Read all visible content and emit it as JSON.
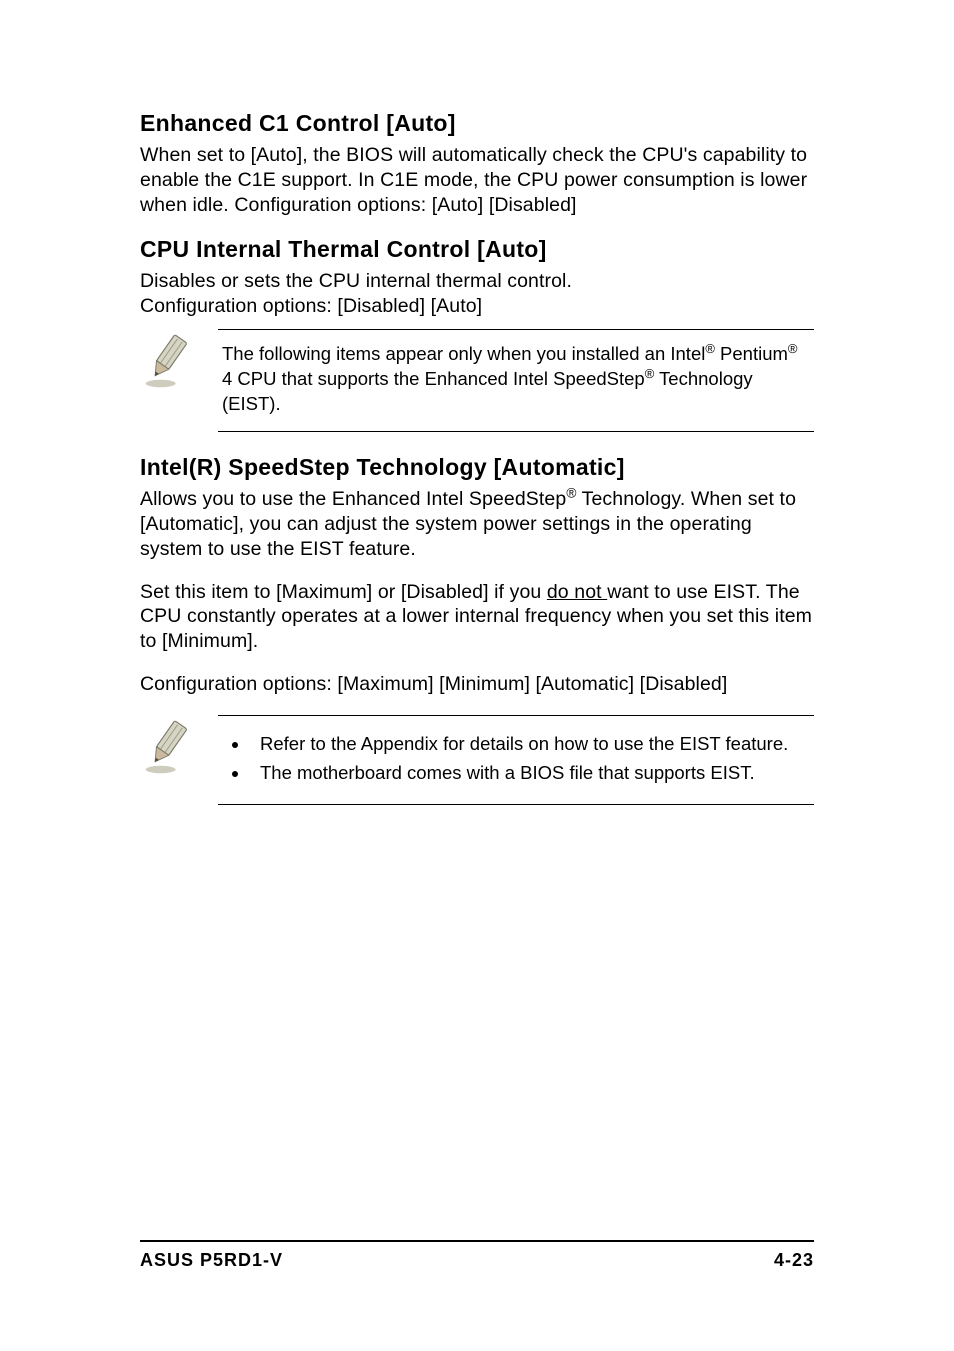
{
  "sections": {
    "s1": {
      "heading": "Enhanced C1 Control [Auto]",
      "body": "When set to [Auto], the BIOS will automatically check the CPU's capability to enable the C1E support. In C1E mode, the CPU power consumption is lower when idle. Configuration options: [Auto] [Disabled]"
    },
    "s2": {
      "heading": "CPU Internal Thermal Control [Auto]",
      "body": "Disables or sets the CPU internal thermal control.\nConfiguration options: [Disabled] [Auto]"
    },
    "note1": {
      "pre": "The following items appear only when you installed an Intel",
      "mid": " Pentium",
      "post": " 4 CPU that supports the Enhanced Intel SpeedStep",
      "tail": " Technology (EIST)."
    },
    "s3": {
      "heading": "Intel(R) SpeedStep Technology [Automatic]",
      "p1_pre": "Allows you to use the Enhanced Intel SpeedStep",
      "p1_post": " Technology. When set to [Automatic], you can adjust the system power settings in the operating system to use the EIST feature.",
      "p2_pre": "Set this item to [Maximum] or [Disabled] if you ",
      "p2_u": "do not ",
      "p2_post": "want to use EIST. The CPU constantly operates at a lower internal frequency when you set this item to [Minimum].",
      "p3": "Configuration options: [Maximum] [Minimum] [Automatic] [Disabled]"
    },
    "note2": {
      "b1": "Refer to the Appendix for details on how to use the EIST feature.",
      "b2": "The motherboard comes with a BIOS file that supports EIST."
    }
  },
  "footer": {
    "left": "ASUS P5RD1-V",
    "right": "4-23"
  },
  "reg": "®"
}
